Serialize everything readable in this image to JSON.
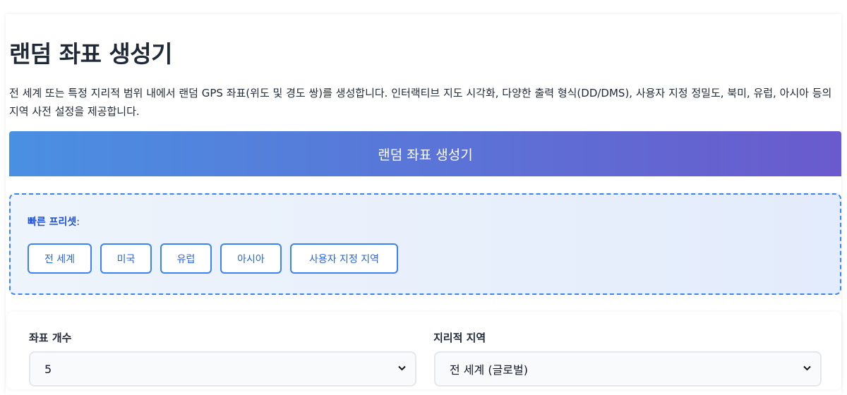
{
  "page": {
    "title": "랜덤 좌표 생성기",
    "description": "전 세계 또는 특정 지리적 범위 내에서 랜덤 GPS 좌표(위도 및 경도 쌍)를 생성합니다. 인터랙티브 지도 시각화, 다양한 출력 형식(DD/DMS), 사용자 지정 정밀도, 북미, 유럽, 아시아 등의 지역 사전 설정을 제공합니다."
  },
  "tool": {
    "header_title": "랜덤 좌표 생성기",
    "colors": {
      "gradient_start": "#4a90e2",
      "gradient_end": "#6a5acd",
      "accent": "#3b82f6"
    }
  },
  "presets": {
    "label": "빠른 프리셋",
    "label_suffix": ":",
    "buttons": [
      {
        "label": "전 세계"
      },
      {
        "label": "미국"
      },
      {
        "label": "유럽"
      },
      {
        "label": "아시아"
      },
      {
        "label": "사용자 지정 지역"
      }
    ]
  },
  "form": {
    "count": {
      "label": "좌표 개수",
      "value": "5"
    },
    "region": {
      "label": "지리적 지역",
      "value": "전 세계 (글로벌)"
    }
  }
}
